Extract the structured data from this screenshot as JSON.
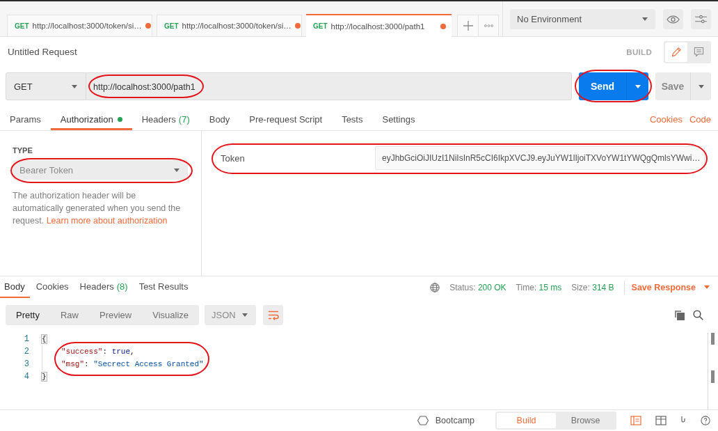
{
  "request_tabs": [
    {
      "method": "GET",
      "url": "http://localhost:3000/token/si…",
      "unsaved": true,
      "selected": false
    },
    {
      "method": "GET",
      "url": "http://localhost:3000/token/si…",
      "unsaved": true,
      "selected": false
    },
    {
      "method": "GET",
      "url": "http://localhost:3000/path1",
      "unsaved": true,
      "selected": true
    }
  ],
  "environment": {
    "value": "No Environment"
  },
  "request_header": {
    "title": "Untitled Request",
    "mode": "BUILD",
    "mode_buttons": [
      {
        "kind": "edit",
        "selected": true
      },
      {
        "kind": "comments",
        "selected": false
      }
    ]
  },
  "url_bar": {
    "method": "GET",
    "url": "http://localhost:3000/path1",
    "url_circled": true,
    "send": "Send",
    "send_circled": true,
    "save": "Save"
  },
  "request_sections": {
    "tabs": [
      {
        "label": "Params",
        "selected": false,
        "dot": false
      },
      {
        "label": "Authorization",
        "selected": true,
        "dot": true
      },
      {
        "label": "Headers",
        "count": "(7)",
        "selected": false,
        "dot": false
      },
      {
        "label": "Body",
        "selected": false,
        "dot": false
      },
      {
        "label": "Pre-request Script",
        "selected": false,
        "dot": false
      },
      {
        "label": "Tests",
        "selected": false,
        "dot": false
      },
      {
        "label": "Settings",
        "selected": false,
        "dot": false
      }
    ],
    "links": [
      "Cookies",
      "Code"
    ]
  },
  "authorization": {
    "type_label": "TYPE",
    "type": "Bearer Token",
    "type_circled": true,
    "help": "The authorization header will be automatically generated when you send the request.",
    "help_link": "Learn more about authorization",
    "fields": [
      {
        "label": "Token",
        "value": "eyJhbGciOiJIUzI1NiIsInR5cCI6IkpXVCJ9.eyJuYW1lIjoiTXVoYW1tYWQgQmlsYWwi…",
        "circled": true
      }
    ]
  },
  "response": {
    "tabs": [
      {
        "label": "Body",
        "selected": true
      },
      {
        "label": "Cookies",
        "selected": false
      },
      {
        "label": "Headers",
        "count": "(8)",
        "selected": false
      },
      {
        "label": "Test Results",
        "selected": false
      }
    ],
    "stats": [
      {
        "label": "Status:",
        "value": "200 OK"
      },
      {
        "label": "Time:",
        "value": "15 ms"
      },
      {
        "label": "Size:",
        "value": "314 B"
      }
    ],
    "save": "Save Response",
    "views": [
      {
        "label": "Pretty",
        "selected": true
      },
      {
        "label": "Raw",
        "selected": false
      },
      {
        "label": "Preview",
        "selected": false
      },
      {
        "label": "Visualize",
        "selected": false
      }
    ],
    "format": "JSON",
    "wrap_lines": true,
    "lines": [
      {
        "number": "1",
        "circled": false,
        "tokens": [
          {
            "kind": "brace",
            "text": "{"
          }
        ],
        "children": [
          {
            "number": "2",
            "circled": true,
            "tokens": [
              {
                "kind": "key",
                "text": "\"success\""
              },
              {
                "kind": "punct",
                "text": ": "
              },
              {
                "kind": "bool",
                "text": "true"
              },
              {
                "kind": "punct",
                "text": ","
              }
            ]
          },
          {
            "number": "3",
            "circled": true,
            "tokens": [
              {
                "kind": "key",
                "text": "\"msg\""
              },
              {
                "kind": "punct",
                "text": ": "
              },
              {
                "kind": "string",
                "text": "\"Secrect Access Granted\""
              }
            ]
          }
        ]
      },
      {
        "number": "4",
        "circled": false,
        "tokens": [
          {
            "kind": "brace",
            "text": "}"
          }
        ]
      }
    ]
  },
  "status_bar": {
    "bootcamp": "Bootcamp",
    "modes": [
      {
        "label": "Build",
        "selected": true
      },
      {
        "label": "Browse",
        "selected": false
      }
    ]
  }
}
